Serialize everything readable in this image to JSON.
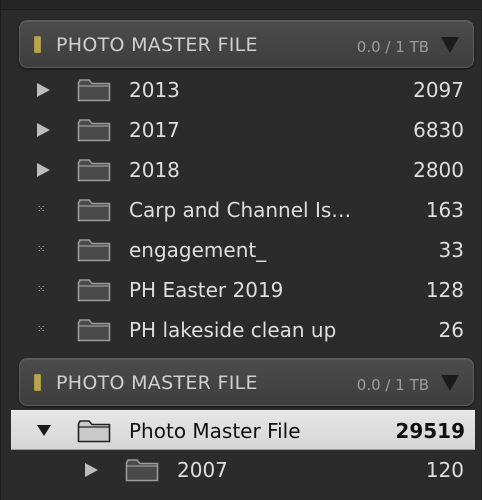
{
  "volumes": [
    {
      "title": "PHOTO MASTER FILE",
      "capacity": "0.0 / 1 TB"
    },
    {
      "title": "PHOTO MASTER FILE",
      "capacity": "0.0 / 1 TB"
    }
  ],
  "folders_a": [
    {
      "label": "2013",
      "count": "2097",
      "disclosure": "collapsed"
    },
    {
      "label": "2017",
      "count": "6830",
      "disclosure": "collapsed"
    },
    {
      "label": "2018",
      "count": "2800",
      "disclosure": "collapsed"
    },
    {
      "label": "Carp and Channel Is…",
      "count": "163",
      "disclosure": "empty"
    },
    {
      "label": "engagement_",
      "count": "33",
      "disclosure": "empty"
    },
    {
      "label": "PH Easter 2019",
      "count": "128",
      "disclosure": "empty"
    },
    {
      "label": "PH lakeside clean up",
      "count": "26",
      "disclosure": "empty"
    }
  ],
  "folders_b": [
    {
      "label": "Photo Master File",
      "count": "29519",
      "disclosure": "expanded",
      "selected": true
    },
    {
      "label": "2007",
      "count": "120",
      "disclosure": "collapsed"
    }
  ],
  "icons": {
    "folder": "folder-icon",
    "volume_indicator": "volume-status-led",
    "collapse": "triangle-down-icon"
  },
  "colors": {
    "panel_bg": "#2b2b2b",
    "header_bg": "#454545",
    "led": "#b7a548",
    "selected_bg": "#dedede",
    "text": "#dedede"
  }
}
